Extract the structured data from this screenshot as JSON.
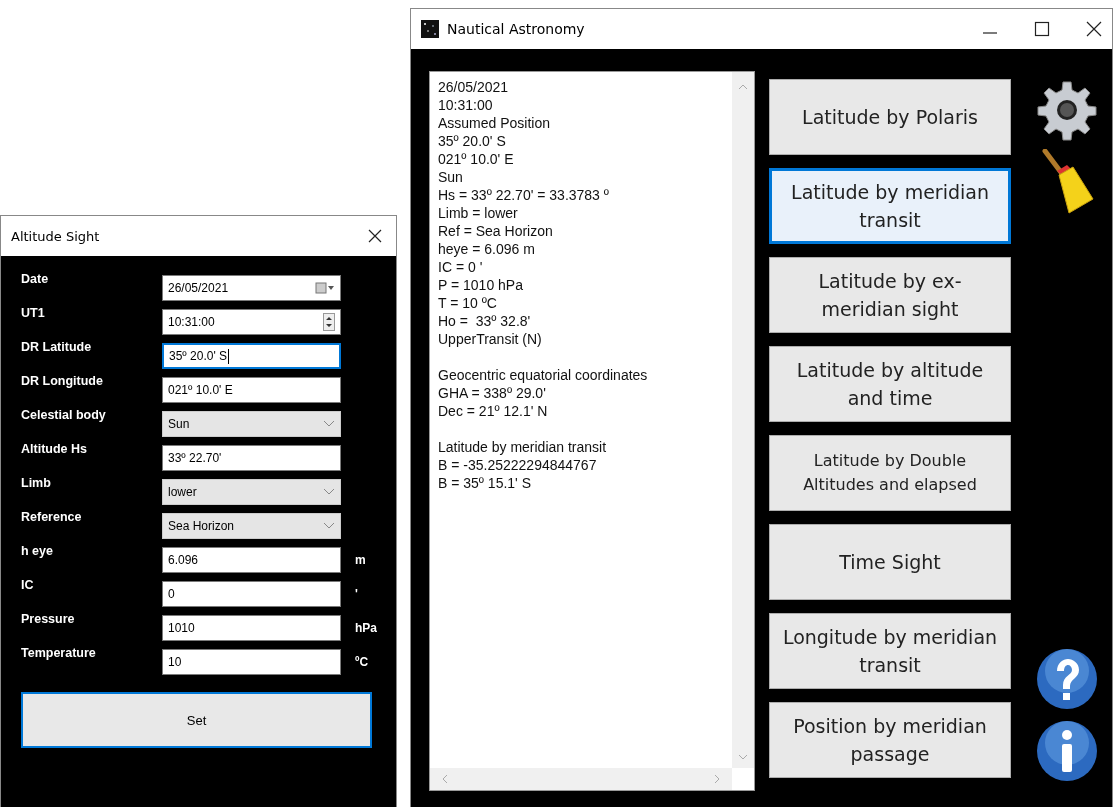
{
  "altitude_window": {
    "title": "Altitude Sight",
    "fields": [
      {
        "label": "Date",
        "kind": "date",
        "value": "26/05/2021",
        "focused": false
      },
      {
        "label": "UT1",
        "kind": "spin",
        "value": "10:31:00",
        "focused": false
      },
      {
        "label": "DR Latitude",
        "kind": "text",
        "value": "35º 20.0' S",
        "focused": true
      },
      {
        "label": "DR Longitude",
        "kind": "text",
        "value": "021º 10.0' E",
        "focused": false
      },
      {
        "label": "Celestial body",
        "kind": "combo",
        "value": "Sun",
        "focused": false
      },
      {
        "label": "Altitude Hs",
        "kind": "text",
        "value": "33º 22.70'",
        "focused": false
      },
      {
        "label": "Limb",
        "kind": "combo",
        "value": "lower",
        "focused": false
      },
      {
        "label": "Reference",
        "kind": "combo",
        "value": "Sea Horizon",
        "focused": false
      },
      {
        "label": "h eye",
        "kind": "text",
        "value": "6.096",
        "unit": "m",
        "focused": false
      },
      {
        "label": "IC",
        "kind": "text",
        "value": "0",
        "unit": "'",
        "focused": false
      },
      {
        "label": "Pressure",
        "kind": "text",
        "value": "1010",
        "unit": "hPa",
        "focused": false
      },
      {
        "label": "Temperature",
        "kind": "text",
        "value": "10",
        "unit": "ºC",
        "focused": false
      }
    ],
    "set_button": {
      "label": "Set",
      "focused": true
    }
  },
  "main_window": {
    "title": "Nautical Astronomy",
    "output": [
      [
        "26/05/2021",
        "10:31:00",
        "Assumed Position",
        "35º 20.0' S",
        "021º 10.0' E",
        "Sun",
        "Hs = 33º 22.70' = 33.3783 º",
        "Limb = lower",
        "Ref = Sea Horizon",
        "heye = 6.096 m",
        "IC = 0 '",
        "P = 1010 hPa",
        "T = 10 ºC",
        "Ho =  33º 32.8'",
        "UpperTransit (N)"
      ],
      [
        "Geocentric equatorial coordinates",
        "GHA = 338º 29.0'",
        "Dec = 21º 12.1' N"
      ],
      [
        "Latitude by meridian transit",
        "B = -35.25222294844767",
        "B = 35º 15.1' S"
      ]
    ],
    "buttons": [
      {
        "label": "Latitude by Polaris",
        "selected": false,
        "small": false
      },
      {
        "label": "Latitude by meridian transit",
        "selected": true,
        "small": false
      },
      {
        "label": "Latitude by ex-meridian sight",
        "selected": false,
        "small": false
      },
      {
        "label": "Latitude by altitude and time",
        "selected": false,
        "small": false
      },
      {
        "label": "Latitude by Double Altitudes and elapsed",
        "selected": false,
        "small": true
      },
      {
        "label": "Time Sight",
        "selected": false,
        "small": false
      },
      {
        "label": "Longitude by meridian transit",
        "selected": false,
        "small": false
      },
      {
        "label": "Position by meridian passage",
        "selected": false,
        "small": false
      }
    ]
  }
}
